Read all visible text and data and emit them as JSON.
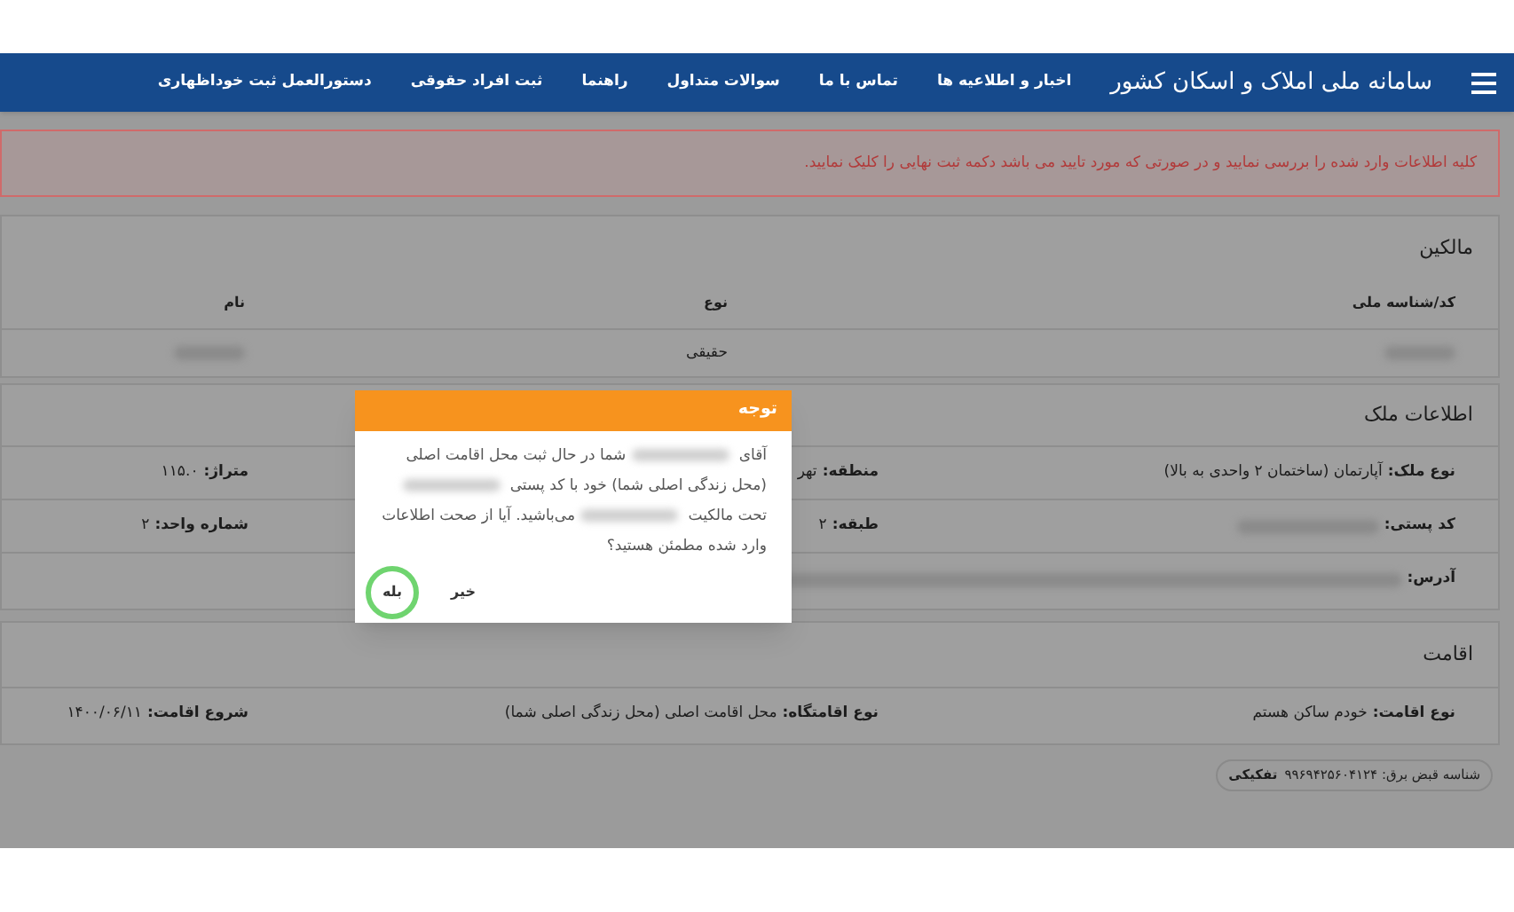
{
  "header": {
    "title": "سامانه ملی املاک و اسکان کشور",
    "menu": [
      {
        "label": "اخبار و اطلاعیه ها"
      },
      {
        "label": "تماس با ما"
      },
      {
        "label": "سوالات متداول"
      },
      {
        "label": "راهنما"
      },
      {
        "label": "ثبت افراد حقوقی"
      },
      {
        "label": "دستورالعمل ثبت خوداظهاری"
      }
    ]
  },
  "alert": "کلیه اطلاعات وارد شده را بررسی نمایید و در صورتی که مورد تایید می باشد دکمه ثبت نهایی را کلیک نمایید.",
  "owners": {
    "title": "مالکین",
    "columns": [
      "کد/شناسه ملی",
      "نوع",
      "نام"
    ],
    "rows": [
      [
        {
          "redacted": true
        },
        {
          "text": "حقیقی",
          "redacted": false
        },
        {
          "redacted": true
        }
      ]
    ]
  },
  "property": {
    "title": "اطلاعات ملک",
    "rows": [
      [
        {
          "label": "نوع ملک:",
          "value": "آپارتمان (ساختمان ۲ واحدی به بالا)",
          "redacted": false
        },
        {
          "label": "منطقه:",
          "value": "تهر",
          "redacted": false
        },
        {
          "label": "متراژ:",
          "value": "۱۱۵.۰",
          "redacted": false
        }
      ],
      [
        {
          "label": "کد پستی:",
          "redacted": true
        },
        {
          "label": "طبقه:",
          "value": "۲",
          "redacted": false
        },
        {
          "label": "شماره واحد:",
          "value": "۲",
          "redacted": false
        }
      ],
      [
        {
          "label": "آدرس:",
          "redacted": true
        }
      ]
    ]
  },
  "residence": {
    "title": "اقامت",
    "rows": [
      [
        {
          "label": "نوع اقامت:",
          "value": "خودم ساکن هستم",
          "redacted": false
        },
        {
          "label": "نوع اقامتگاه:",
          "value": "محل اقامت اصلی (محل زندگی اصلی شما)",
          "redacted": false
        },
        {
          "label": "شروع اقامت:",
          "value": "۱۴۰۰/۰۶/۱۱",
          "redacted": false
        }
      ]
    ]
  },
  "bill": {
    "label": "شناسه قبض برق: ۹۹۶۹۴۲۵۶۰۴۱۲۴",
    "tag": "تفکیکی"
  },
  "dialog": {
    "title": "توجه",
    "message": [
      {
        "kind": "text",
        "text": "آقای"
      },
      {
        "kind": "redacted"
      },
      {
        "kind": "text",
        "text": "شما در حال ثبت محل اقامت اصلی (محل زندگی اصلی شما) خود با کد پستی"
      },
      {
        "kind": "redacted"
      },
      {
        "kind": "text",
        "text": "تحت مالکیت"
      },
      {
        "kind": "redacted"
      },
      {
        "kind": "text",
        "text": "می‌باشید. آیا از صحت اطلاعات وارد شده مطمئن هستید؟"
      }
    ],
    "buttons": [
      {
        "label": "خیر",
        "highlighted": false
      },
      {
        "label": "بله",
        "highlighted": true
      }
    ]
  }
}
